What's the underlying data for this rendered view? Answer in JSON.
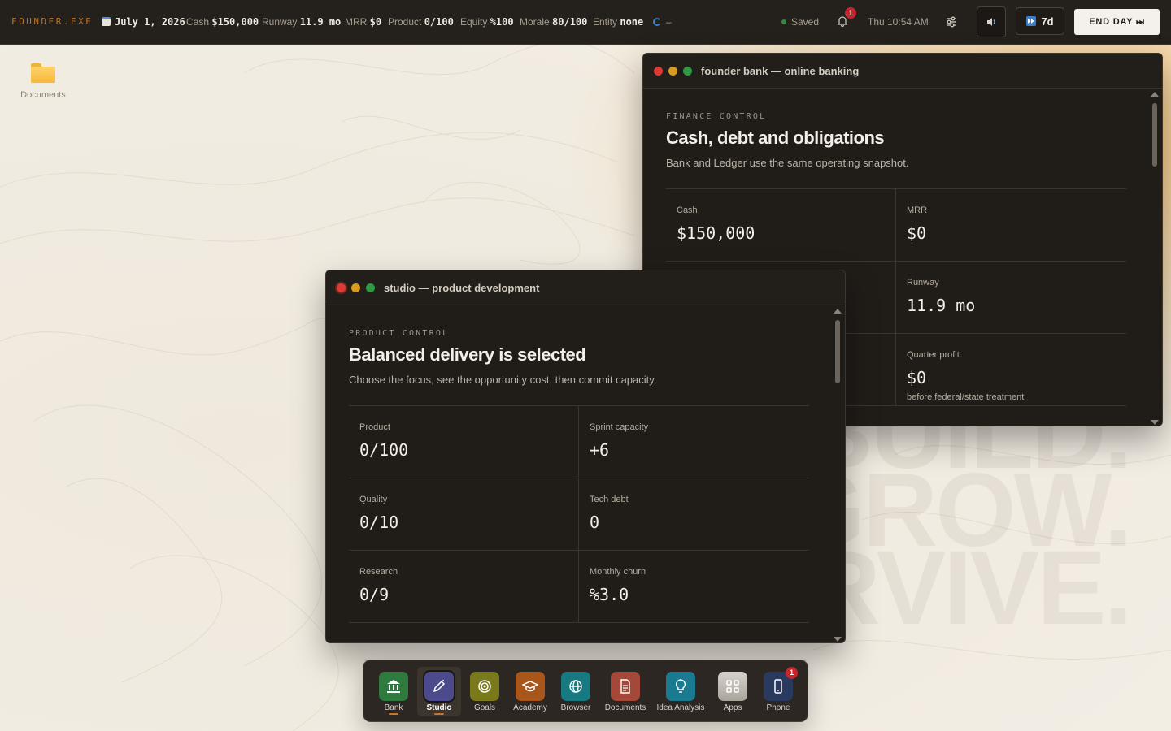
{
  "topbar": {
    "logo": "FOUNDER.EXE",
    "date": "July 1, 2026",
    "cash_label": "Cash",
    "cash_value": "$150,000",
    "runway_label": "Runway",
    "runway_value": "11.9 mo",
    "mrr_label": "MRR",
    "mrr_value": "$0",
    "product_label": "Product",
    "product_value": "0/100",
    "equity_label": "Equity",
    "equity_value": "%100",
    "morale_label": "Morale",
    "morale_value": "80/100",
    "entity_label": "Entity",
    "entity_value": "none",
    "sync_value": "–",
    "saved": "Saved",
    "notification_count": "1",
    "time": "Thu 10:54 AM",
    "fast_forward": "7d",
    "end_day": "END DAY ⏭"
  },
  "desktop": {
    "icon_label": "Documents",
    "bg_words": [
      "BUILD.",
      "GROW.",
      "SURVIVE."
    ]
  },
  "bank_window": {
    "title": "founder bank — online banking",
    "eyebrow": "FINANCE CONTROL",
    "heading": "Cash, debt and obligations",
    "sub": "Bank and Ledger use the same operating snapshot.",
    "cells": [
      {
        "label": "Cash",
        "value": "$150,000",
        "note": ""
      },
      {
        "label": "MRR",
        "value": "$0",
        "note": ""
      },
      {
        "label": "",
        "value": "",
        "note": ""
      },
      {
        "label": "Runway",
        "value": "11.9 mo",
        "note": ""
      },
      {
        "label": "",
        "value": "",
        "note": ""
      },
      {
        "label": "Quarter profit",
        "value": "$0",
        "note": "before federal/state treatment"
      }
    ]
  },
  "studio_window": {
    "title": "studio — product development",
    "eyebrow": "PRODUCT CONTROL",
    "heading": "Balanced delivery is selected",
    "sub": "Choose the focus, see the opportunity cost, then commit capacity.",
    "cells": [
      {
        "label": "Product",
        "value": "0/100"
      },
      {
        "label": "Sprint capacity",
        "value": "+6"
      },
      {
        "label": "Quality",
        "value": "0/10"
      },
      {
        "label": "Tech debt",
        "value": "0"
      },
      {
        "label": "Research",
        "value": "0/9"
      },
      {
        "label": "Monthly churn",
        "value": "%3.0"
      }
    ]
  },
  "dock": {
    "items": [
      {
        "label": "Bank",
        "icon": "bank-icon",
        "color": "#2f7a3e"
      },
      {
        "label": "Studio",
        "icon": "pen-icon",
        "color": "#4a4a8c"
      },
      {
        "label": "Goals",
        "icon": "target-icon",
        "color": "#7a7a1c"
      },
      {
        "label": "Academy",
        "icon": "graduation-cap-icon",
        "color": "#a8561a"
      },
      {
        "label": "Browser",
        "icon": "globe-icon",
        "color": "#177a80"
      },
      {
        "label": "Documents",
        "icon": "document-icon",
        "color": "#a4483a"
      },
      {
        "label": "Idea Analysis",
        "icon": "lightbulb-icon",
        "color": "#1a7a90"
      },
      {
        "label": "Apps",
        "icon": "grid-icon",
        "color": "#bdb8b0"
      },
      {
        "label": "Phone",
        "icon": "phone-icon",
        "color": "#2a3a5e"
      }
    ],
    "phone_badge": "1"
  }
}
